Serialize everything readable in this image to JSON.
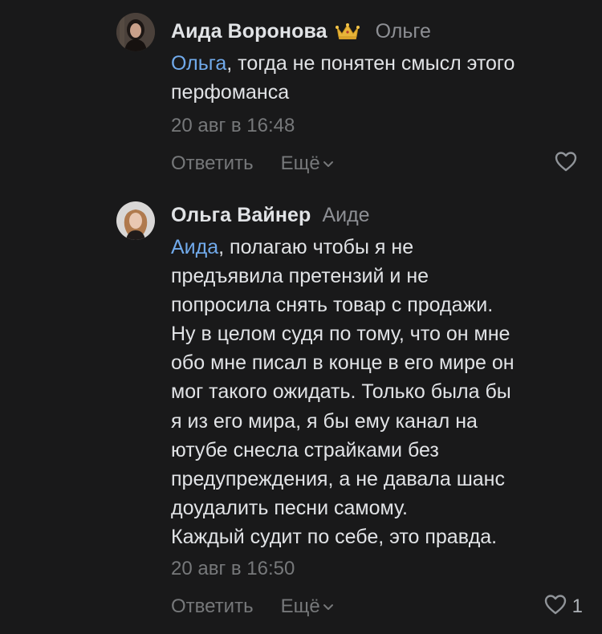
{
  "comments": [
    {
      "author": "Аида Воронова",
      "reply_to": "Ольге",
      "badge_icon": "crown-icon",
      "mention": "Ольга",
      "text_lines": [
        ", тогда не понятен смысл этого",
        "перфоманса"
      ],
      "timestamp": "20 авг в 16:48",
      "actions": {
        "reply": "Ответить",
        "more": "Ещё"
      },
      "likes": ""
    },
    {
      "author": "Ольга Вайнер",
      "reply_to": "Аиде",
      "mention": "Аида",
      "text_lines": [
        ", полагаю чтобы я не",
        "предъявила претензий и не",
        "попросила снять товар с продажи.",
        "Ну в целом судя по тому, что он мне",
        "обо мне писал в конце в его мире он",
        "мог такого ожидать. Только была бы",
        "я из его мира, я бы ему канал на",
        "ютубе снесла страйками без",
        "предупреждения, а не давала шанс",
        "доудалить песни самому.",
        "Каждый судит по себе, это правда."
      ],
      "timestamp": "20 авг в 16:50",
      "actions": {
        "reply": "Ответить",
        "more": "Ещё"
      },
      "likes": "1"
    }
  ],
  "colors": {
    "background": "#19191a",
    "text": "#e1e3e6",
    "secondary": "#76787a",
    "mention": "#71aaeb"
  }
}
